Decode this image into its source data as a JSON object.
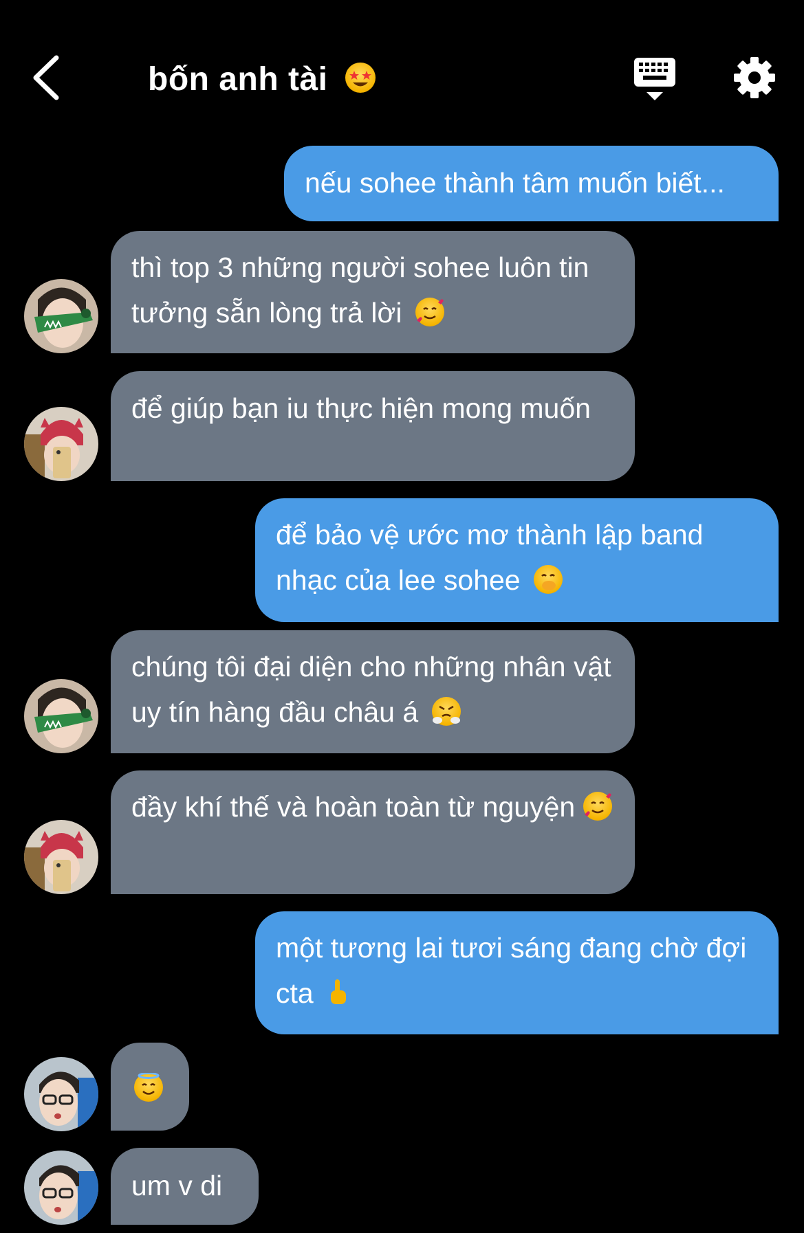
{
  "header": {
    "title": "bốn anh tài",
    "title_emoji": "star-struck-emoji"
  },
  "messages": [
    {
      "side": "out",
      "text": "nếu sohee thành tâm muốn biết..."
    },
    {
      "side": "in",
      "sender": "avatar-crocodile",
      "text": "thì top 3 những người sohee luôn tin tưởng sẵn lòng trả lời",
      "emoji": "smiling-face-with-hearts-emoji"
    },
    {
      "side": "in",
      "sender": "avatar-red-hat",
      "text": "để giúp bạn iu thực hiện mong muốn"
    },
    {
      "side": "out",
      "text": "để bảo vệ ước mơ thành lập band nhạc của lee sohee",
      "emoji": "face-with-hand-over-mouth-emoji"
    },
    {
      "side": "in",
      "sender": "avatar-crocodile",
      "text": "chúng tôi đại diện cho những nhân vật uy tín hàng đầu châu á",
      "emoji": "face-with-steam-emoji"
    },
    {
      "side": "in",
      "sender": "avatar-red-hat",
      "text": "đầy khí thế và hoàn toàn từ nguyện",
      "emoji": "smiling-face-with-hearts-emoji"
    },
    {
      "side": "out",
      "text": "một tương lai tươi sáng đang chờ đợi cta",
      "emoji": "pointing-up-hand-emoji"
    },
    {
      "side": "in",
      "sender": "avatar-glasses",
      "text": "",
      "emoji": "smiling-face-with-halo-emoji"
    },
    {
      "side": "in",
      "sender": "avatar-glasses",
      "text": "um v di"
    }
  ],
  "colors": {
    "background": "#000000",
    "incoming_bubble": "#6c7785",
    "outgoing_bubble": "#4a9be6",
    "text": "#ffffff"
  },
  "icons": [
    "back-icon",
    "keyboard-icon",
    "gear-icon"
  ]
}
